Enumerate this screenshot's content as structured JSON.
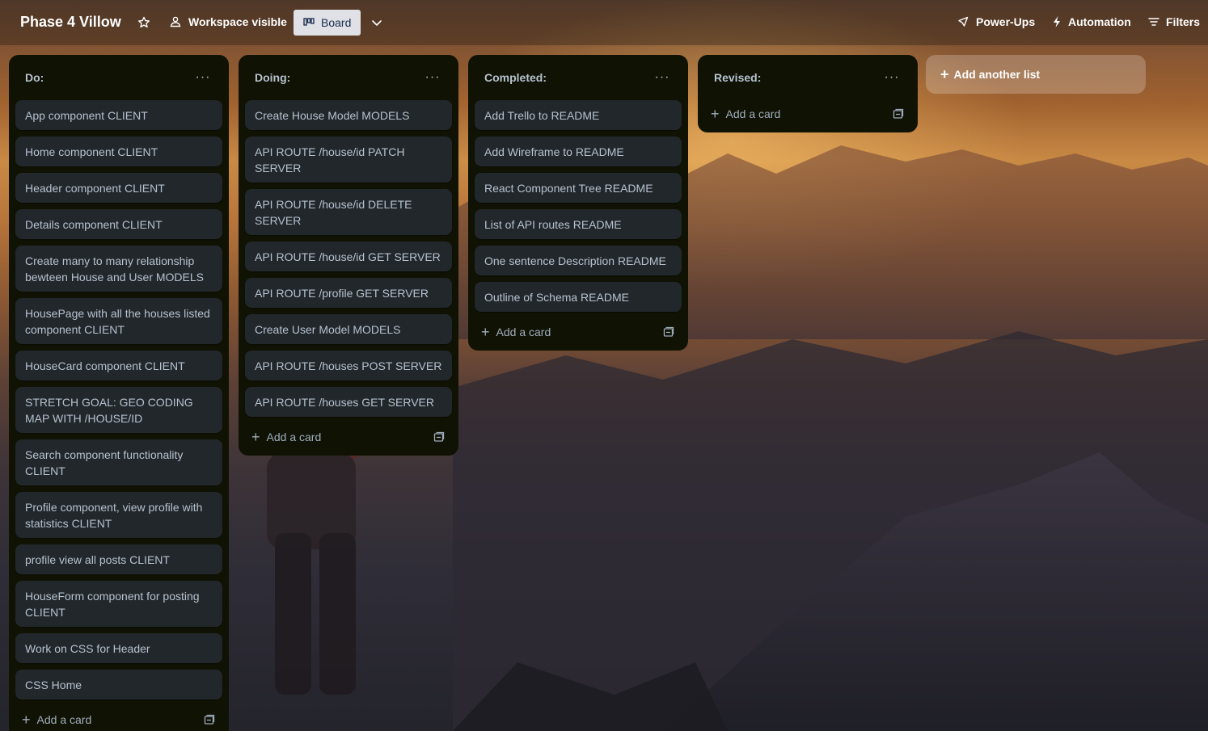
{
  "board": {
    "title": "Phase 4 Villow",
    "visibility_label": "Workspace visible",
    "view_label": "Board"
  },
  "header_actions": {
    "power_ups": "Power-Ups",
    "automation": "Automation",
    "filters": "Filters"
  },
  "lists": [
    {
      "title": "Do:",
      "cards": [
        "App component CLIENT",
        "Home component CLIENT",
        "Header component CLIENT",
        "Details component CLIENT",
        "Create many to many relationship bewteen House and User MODELS",
        "HousePage with all the houses listed component CLIENT",
        "HouseCard component CLIENT",
        "STRETCH GOAL: GEO CODING MAP WITH /HOUSE/ID",
        "Search component functionality CLIENT",
        "Profile component, view profile with statistics CLIENT",
        "profile view all posts CLIENT",
        "HouseForm component for posting CLIENT",
        "Work on CSS for Header",
        "CSS Home"
      ],
      "add_label": "Add a card"
    },
    {
      "title": "Doing:",
      "cards": [
        "Create House Model MODELS",
        "API ROUTE /house/id PATCH SERVER",
        "API ROUTE /house/id DELETE SERVER",
        "API ROUTE /house/id GET SERVER",
        "API ROUTE /profile GET SERVER",
        "Create User Model MODELS",
        "API ROUTE /houses POST SERVER",
        "API ROUTE /houses GET SERVER"
      ],
      "add_label": "Add a card"
    },
    {
      "title": "Completed:",
      "cards": [
        "Add Trello to README",
        "Add Wireframe to README",
        "React Component Tree README",
        "List of API routes README",
        "One sentence Description README",
        "Outline of Schema README"
      ],
      "add_label": "Add a card"
    },
    {
      "title": "Revised:",
      "cards": [],
      "add_label": "Add a card"
    }
  ],
  "add_list_label": "Add another list"
}
